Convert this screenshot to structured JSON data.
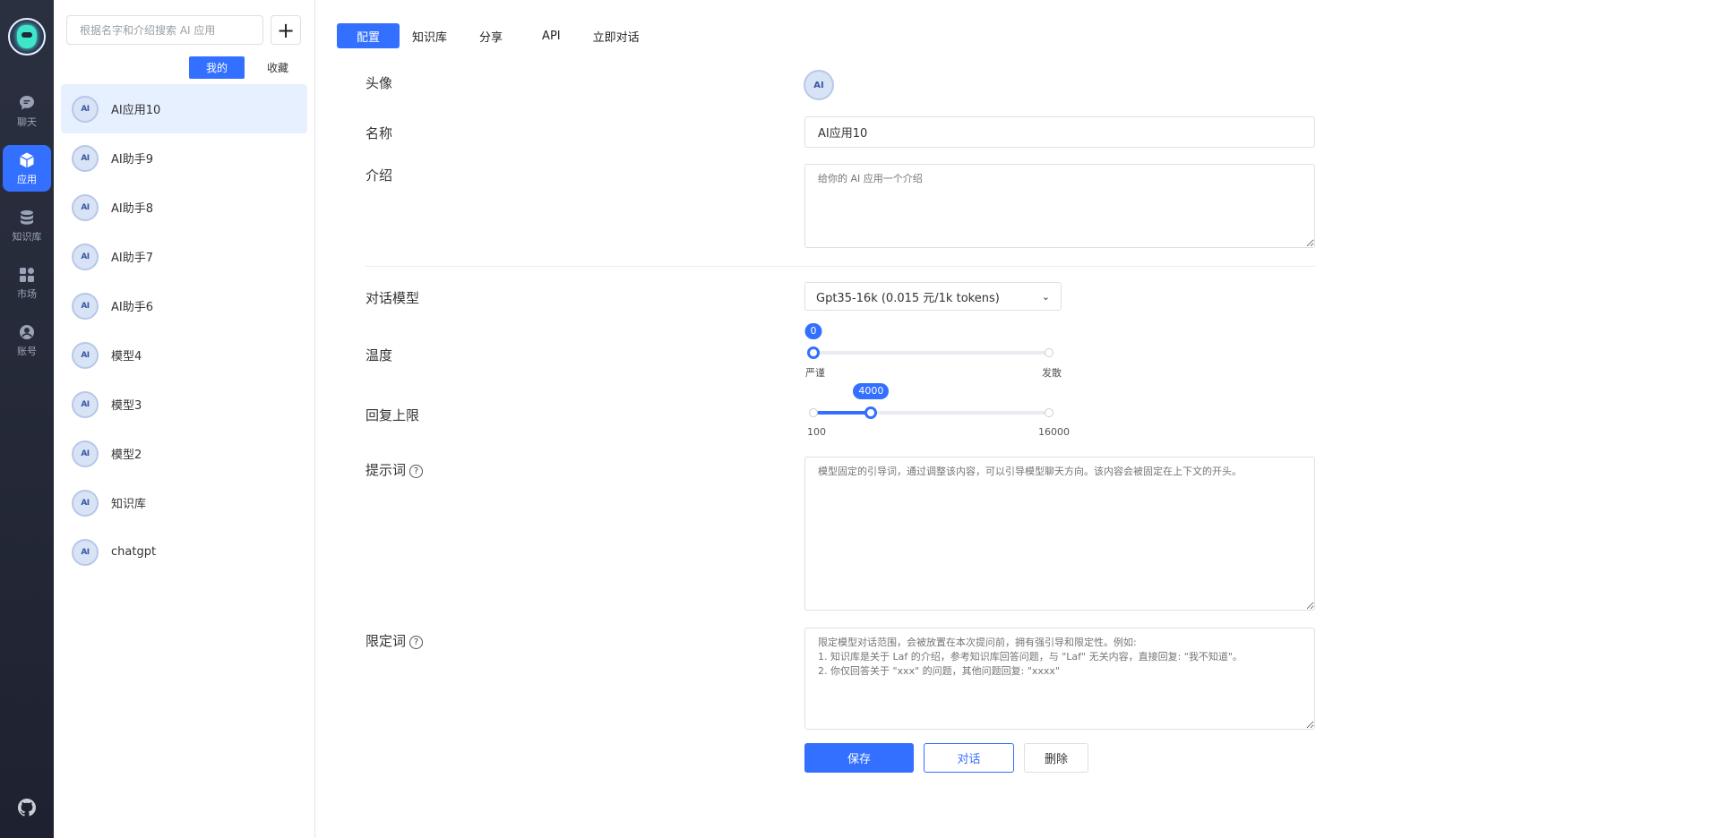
{
  "nav": {
    "items": [
      {
        "label": "聊天",
        "icon": "chat-icon"
      },
      {
        "label": "应用",
        "icon": "cube-icon",
        "active": true
      },
      {
        "label": "知识库",
        "icon": "database-icon"
      },
      {
        "label": "市场",
        "icon": "grid-icon"
      },
      {
        "label": "账号",
        "icon": "user-icon"
      }
    ]
  },
  "list": {
    "search_placeholder": "根据名字和介绍搜索 AI 应用",
    "add_label": "+",
    "tabs": [
      "我的",
      "收藏"
    ],
    "apps": [
      "AI应用10",
      "AI助手9",
      "AI助手8",
      "AI助手7",
      "AI助手6",
      "模型4",
      "模型3",
      "模型2",
      "知识库",
      "chatgpt"
    ],
    "avatar_text": "AI"
  },
  "main": {
    "tabs": [
      "配置",
      "知识库",
      "分享",
      "API",
      "立即对话"
    ],
    "avatar_label": "头像",
    "name_label": "名称",
    "name_value": "AI应用10",
    "intro_label": "介绍",
    "intro_placeholder": "给你的 AI 应用一个介绍",
    "model_label": "对话模型",
    "model_value": "Gpt35-16k (0.015 元/1k tokens)",
    "temp_label": "温度",
    "temp_value": "0",
    "temp_min_label": "严谨",
    "temp_max_label": "发散",
    "temp_fraction": 0,
    "limit_label": "回复上限",
    "limit_value": "4000",
    "limit_min": "100",
    "limit_max": "16000",
    "limit_fraction": 0.245,
    "prompt_label": "提示词",
    "prompt_placeholder": "模型固定的引导词，通过调整该内容，可以引导模型聊天方向。该内容会被固定在上下文的开头。",
    "limit_words_label": "限定词",
    "limit_words_placeholder": "限定模型对话范围，会被放置在本次提问前，拥有强引导和限定性。例如:\n1. 知识库是关于 Laf 的介绍，参考知识库回答问题，与 \"Laf\" 无关内容，直接回复: \"我不知道\"。\n2. 你仅回答关于 \"xxx\" 的问题，其他问题回复: \"xxxx\"",
    "save_label": "保存",
    "chat_label": "对话",
    "delete_label": "删除",
    "help_glyph": "?"
  },
  "colors": {
    "accent": "#3370ff",
    "nav_bg": "#2b3040",
    "active_item_bg": "#e7f0ff"
  }
}
